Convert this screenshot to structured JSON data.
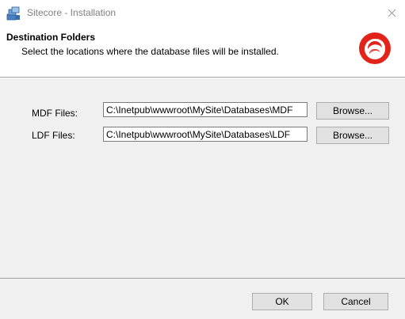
{
  "window": {
    "title": "Sitecore - Installation",
    "close_symbol": "×"
  },
  "header": {
    "title": "Destination Folders",
    "subtitle": "Select the locations where the database files will be installed."
  },
  "form": {
    "mdf_label": "MDF Files:",
    "mdf_value": "C:\\Inetpub\\wwwroot\\MySite\\Databases\\MDF",
    "ldf_label": "LDF Files:",
    "ldf_value": "C:\\Inetpub\\wwwroot\\MySite\\Databases\\LDF",
    "browse_label": "Browse..."
  },
  "footer": {
    "ok_label": "OK",
    "cancel_label": "Cancel"
  },
  "colors": {
    "brand_red": "#e2231a",
    "panel_bg": "#f0f0f0",
    "button_bg": "#e1e1e1"
  },
  "icons": {
    "app": "installer-icon",
    "logo": "sitecore-logo",
    "close": "close-icon"
  }
}
